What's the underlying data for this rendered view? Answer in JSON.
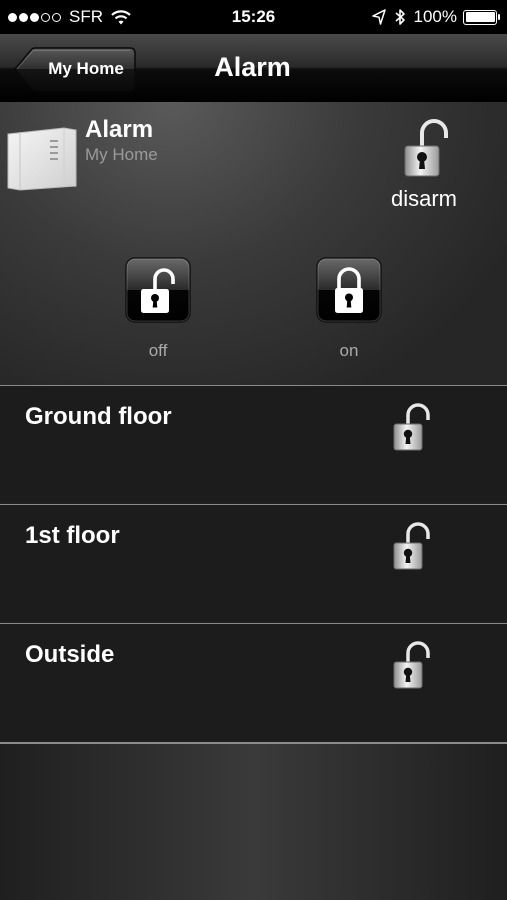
{
  "status_bar": {
    "carrier": "SFR",
    "signal_bars_filled": 3,
    "signal_bars_total": 5,
    "time": "15:26",
    "battery": "100%",
    "battery_level": 1.0
  },
  "nav": {
    "back_label": "My Home",
    "title": "Alarm"
  },
  "device": {
    "name": "Alarm",
    "location": "My Home",
    "state_label": "disarm",
    "state_icon": "open-padlock-icon"
  },
  "controls": [
    {
      "label": "off",
      "icon": "open-padlock-icon"
    },
    {
      "label": "on",
      "icon": "closed-padlock-icon"
    }
  ],
  "zones": [
    {
      "name": "Ground floor",
      "icon": "open-padlock-icon"
    },
    {
      "name": "1st floor",
      "icon": "open-padlock-icon"
    },
    {
      "name": "Outside",
      "icon": "open-padlock-icon"
    }
  ],
  "colors": {
    "background": "#1c1c1c",
    "panel": "#3a3a3a",
    "separator": "#8a8a8a",
    "subtitle": "#9a9a9a"
  }
}
